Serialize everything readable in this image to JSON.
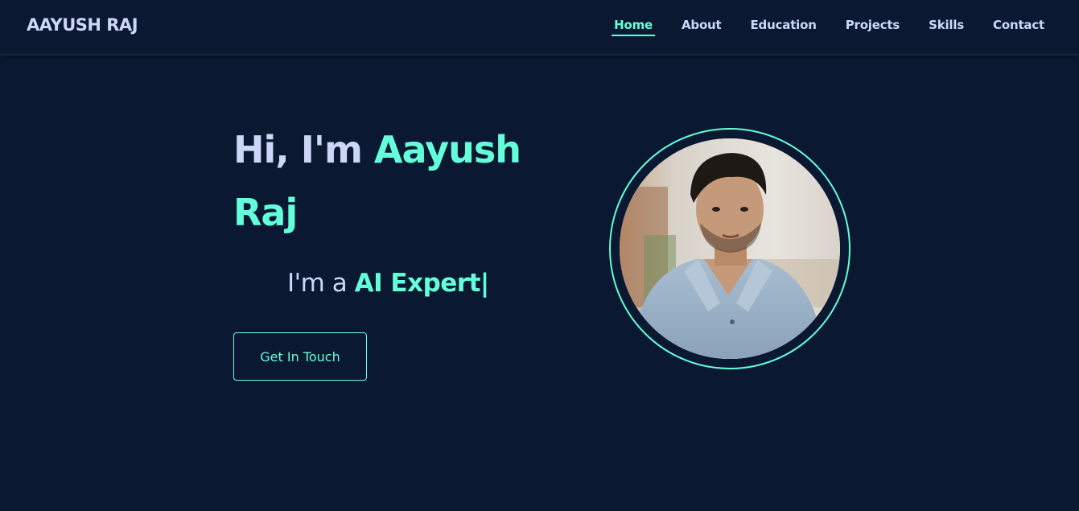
{
  "brand": {
    "name": "AAYUSH RAJ"
  },
  "nav": {
    "items": [
      {
        "label": "Home",
        "active": true
      },
      {
        "label": "About",
        "active": false
      },
      {
        "label": "Education",
        "active": false
      },
      {
        "label": "Projects",
        "active": false
      },
      {
        "label": "Skills",
        "active": false
      },
      {
        "label": "Contact",
        "active": false
      }
    ]
  },
  "hero": {
    "greeting": "Hi, I'm",
    "name": "Aayush Raj",
    "tagline_prefix": "I'm a",
    "role": "AI Expert",
    "cursor": "|",
    "cta_label": "Get In Touch"
  },
  "colors": {
    "background": "#0a1931",
    "accent": "#64ffda",
    "text": "#ccd6f6"
  },
  "icons": {
    "profile_photo": "profile-photo"
  }
}
